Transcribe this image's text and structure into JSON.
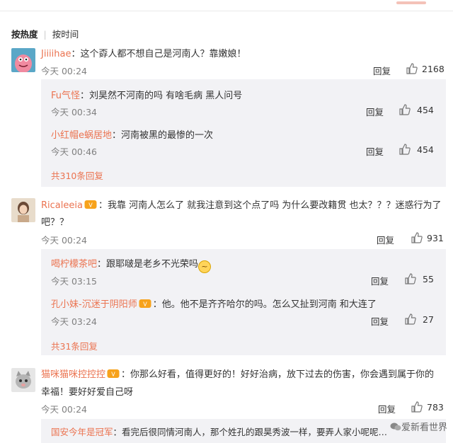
{
  "sort": {
    "active": "按热度",
    "other": "按时间"
  },
  "comments": [
    {
      "user": "Jiiiihae",
      "text": "：这个孬人都不想自己是河南人？靠嫩娘！",
      "time": "今天 00:24",
      "reply": "回复",
      "likes": "2168",
      "replies": [
        {
          "user": "Fu气怪",
          "text": "：刘昊然不河南的吗 有啥毛病 黑人问号",
          "time": "今天 00:34",
          "reply": "回复",
          "likes": "454"
        },
        {
          "user": "小红帽e蜗居地",
          "text": "：河南被黑的最惨的一次",
          "time": "今天 00:46",
          "reply": "回复",
          "likes": "454"
        }
      ],
      "more": "共310条回复"
    },
    {
      "user": "Ricaleeia",
      "text_line1": "：我靠 河南人怎么了 就我注意到这个点了吗 为什么要改籍贯 也太？？？迷惑行为了",
      "text_line2": "吧？？",
      "time": "今天 00:24",
      "reply": "回复",
      "likes": "931",
      "replies": [
        {
          "user": "喝柠檬茶吧",
          "text": "：跟耶啵是老乡不光荣吗",
          "time": "今天 03:15",
          "reply": "回复",
          "likes": "55"
        },
        {
          "user": "孔小妹-沉迷于阴阳师",
          "text": "：他。他不是齐齐哈尔的吗。怎么又扯到河南 和大连了",
          "time": "今天 03:24",
          "reply": "回复",
          "likes": "27"
        }
      ],
      "more": "共31条回复"
    },
    {
      "user": "猫咪猫咪控控控",
      "text_line1": "：你那么好看，值得更好的！好好治病，放下过去的伤害，你会遇到属于你的",
      "text_line2": "幸福！要好好爱自己呀",
      "time": "今天 00:24",
      "reply": "回复",
      "likes": "783",
      "replies": [
        {
          "user": "国安今年是冠军",
          "text": "：看完后很同情河南人，那个姓孔的跟昊秀波一样，要弄人家小呢呢…"
        }
      ]
    }
  ],
  "watermark": "爱新看世界",
  "colors": {
    "accent": "#eb7350",
    "subbg": "#f2f2f5"
  },
  "icons": {
    "like": "thumbs-up-icon",
    "vip": "vip-badge-icon",
    "emoji": "worried-face-emoji"
  }
}
